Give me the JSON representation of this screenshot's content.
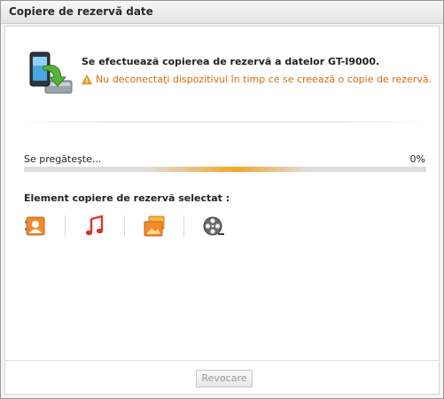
{
  "window": {
    "title": "Copiere de rezervă date"
  },
  "header": {
    "heading": "Se efectuează copierea de rezervă a datelor GT-I9000.",
    "warning": "Nu deconectaţi dispozitivul în timp ce se creează o copie de rezervă."
  },
  "progress": {
    "status_label": "Se pregăteşte...",
    "percent_text": "0%",
    "value": 0
  },
  "selection": {
    "title": "Element copiere de rezervă selectat :",
    "items": [
      "contacts-icon",
      "music-icon",
      "photos-icon",
      "video-icon"
    ]
  },
  "footer": {
    "cancel_label": "Revocare"
  },
  "colors": {
    "accent": "#f3a52b",
    "warning": "#d86a0f"
  }
}
